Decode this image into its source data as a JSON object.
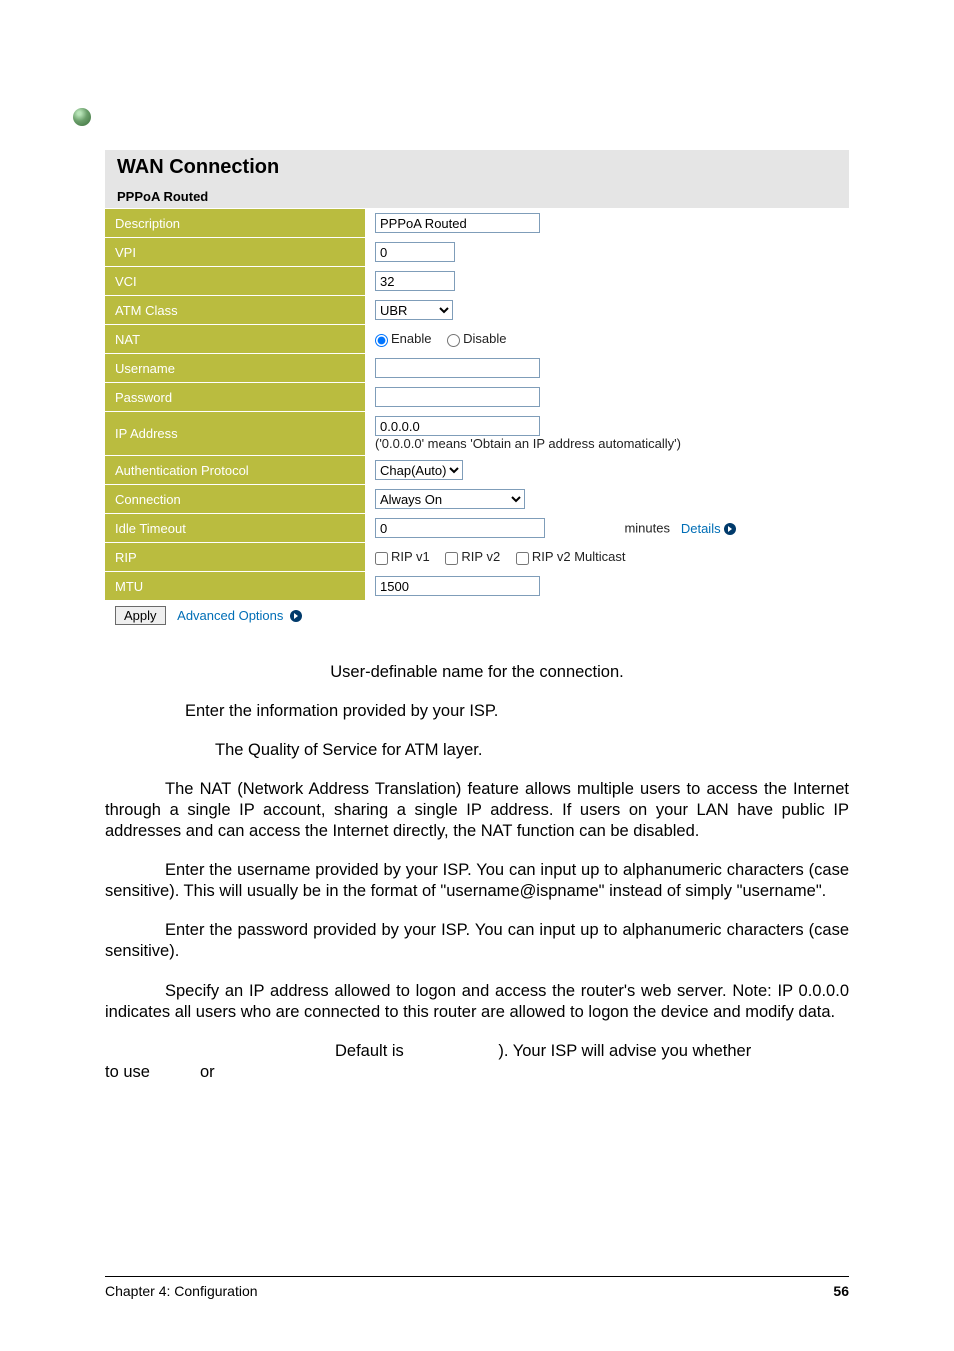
{
  "panel": {
    "title": "WAN Connection",
    "section": "PPPoA Routed",
    "rows": {
      "description": {
        "label": "Description",
        "value": "PPPoA Routed"
      },
      "vpi": {
        "label": "VPI",
        "value": "0"
      },
      "vci": {
        "label": "VCI",
        "value": "32"
      },
      "atm": {
        "label": "ATM Class",
        "selected": "UBR"
      },
      "nat": {
        "label": "NAT",
        "enable": "Enable",
        "disable": "Disable"
      },
      "username": {
        "label": "Username",
        "value": ""
      },
      "password": {
        "label": "Password",
        "value": ""
      },
      "ip": {
        "label": "IP Address",
        "value": "0.0.0.0",
        "hint": "('0.0.0.0' means 'Obtain an IP address automatically')"
      },
      "auth": {
        "label": "Authentication Protocol",
        "selected": "Chap(Auto)"
      },
      "connection": {
        "label": "Connection",
        "selected": "Always On"
      },
      "idle": {
        "label": "Idle Timeout",
        "value": "0",
        "unit": "minutes",
        "details": "Details"
      },
      "rip": {
        "label": "RIP",
        "v1": "RIP v1",
        "v2": "RIP v2",
        "v2m": "RIP v2 Multicast"
      },
      "mtu": {
        "label": "MTU",
        "value": "1500"
      }
    },
    "apply": "Apply",
    "advanced": "Advanced Options"
  },
  "descriptions": {
    "p1": "User-definable name for the connection.",
    "p2": "Enter the information provided by your ISP.",
    "p3": "The Quality of Service for ATM layer.",
    "p4": "The NAT (Network Address Translation) feature allows multiple users to access the Internet through a single IP account, sharing a single IP address. If users on your LAN have public IP addresses and can access the Internet directly, the NAT function can be disabled.",
    "p5": "Enter the username provided by your ISP. You can input up to alphanumeric characters (case sensitive). This will usually be in the format of \"username@ispname\" instead of simply \"username\".",
    "p6": "Enter the password provided by your ISP. You can input up to alphanumeric characters (case sensitive).",
    "p7": "Specify an IP address allowed to logon and access the router's web server. Note:  IP 0.0.0.0 indicates all users who are connected to this router are allowed to logon the device and modify data.",
    "p8a": "Default is",
    "p8b": "). Your ISP will advise you whether",
    "p9a": "to use",
    "p9b": "or"
  },
  "footer": {
    "chapter": "Chapter 4: Configuration",
    "page": "56"
  }
}
